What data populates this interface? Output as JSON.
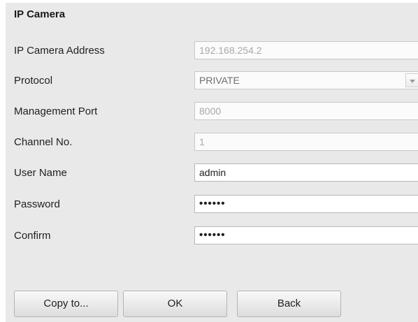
{
  "section_title": "IP Camera",
  "fields": {
    "address": {
      "label": "IP Camera Address",
      "value": "192.168.254.2"
    },
    "protocol": {
      "label": "Protocol",
      "value": "PRIVATE"
    },
    "management_port": {
      "label": "Management Port",
      "value": "8000"
    },
    "channel": {
      "label": "Channel No.",
      "value": "1"
    },
    "user_name": {
      "label": "User Name",
      "value": "admin"
    },
    "password": {
      "label": "Password",
      "value": "••••••"
    },
    "confirm": {
      "label": "Confirm",
      "value": "••••••"
    }
  },
  "buttons": {
    "copy": "Copy to...",
    "ok": "OK",
    "back": "Back"
  },
  "icons": {
    "protocol_dropdown": "chevron-down-icon"
  },
  "colors": {
    "panel_background": "#e9e9e9",
    "disabled_text": "#a8a8a8",
    "field_border": "#b7b7b7"
  }
}
